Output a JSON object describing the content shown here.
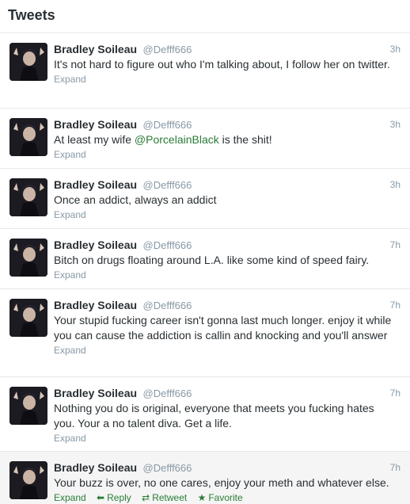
{
  "header": {
    "title": "Tweets"
  },
  "tweets": [
    {
      "name": "Bradley Soileau",
      "handle": "@Defff666",
      "time": "3h",
      "text": "It's not hard to figure out who I'm talking about, I follow her on twitter.",
      "expand": "Expand"
    },
    {
      "name": "Bradley Soileau",
      "handle": "@Defff666",
      "time": "3h",
      "text_before": "At least my wife ",
      "mention": "@PorcelainBlack",
      "text_after": " is the shit!",
      "expand": "Expand"
    },
    {
      "name": "Bradley Soileau",
      "handle": "@Defff666",
      "time": "3h",
      "text": "Once an addict, always an addict",
      "expand": "Expand"
    },
    {
      "name": "Bradley Soileau",
      "handle": "@Defff666",
      "time": "7h",
      "text": "Bitch on drugs floating around L.A. like some kind of speed fairy.",
      "expand": "Expand"
    },
    {
      "name": "Bradley Soileau",
      "handle": "@Defff666",
      "time": "7h",
      "text": "Your stupid fucking career isn't gonna last much longer. enjoy it while you can cause the addiction is callin and knocking and you'll answer",
      "expand": "Expand"
    },
    {
      "name": "Bradley Soileau",
      "handle": "@Defff666",
      "time": "7h",
      "text": "Nothing you do is original, everyone that meets you fucking hates you. Your a no talent diva. Get a life.",
      "expand": "Expand"
    },
    {
      "name": "Bradley Soileau",
      "handle": "@Defff666",
      "time": "7h",
      "text": "Your buzz is over, no one cares, enjoy your meth and whatever else.",
      "expand": "Expand",
      "reply": "Reply",
      "retweet": "Retweet",
      "favorite": "Favorite"
    }
  ],
  "colors": {
    "link": "#2a7c37",
    "muted": "#8899a6",
    "text": "#292f33",
    "hover_bg": "#f5f5f5"
  },
  "icons": {
    "reply": "reply-arrow-icon",
    "retweet": "retweet-icon",
    "favorite": "star-icon"
  }
}
